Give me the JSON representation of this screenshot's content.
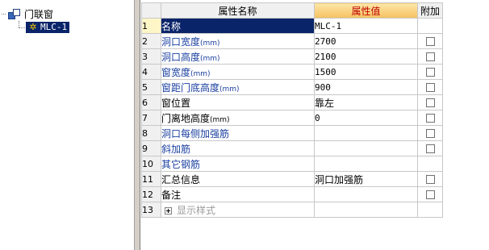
{
  "tree": {
    "root_label": "门联窗",
    "child_label": "MLC-1"
  },
  "grid": {
    "headers": {
      "name": "属性名称",
      "value": "属性值",
      "extra": "附加"
    },
    "rows": [
      {
        "num": "1",
        "name": "名称",
        "unit": "",
        "value": "MLC-1",
        "style": "blue",
        "checkbox": false,
        "selected": true
      },
      {
        "num": "2",
        "name": "洞口宽度",
        "unit": "(mm)",
        "value": "2700",
        "style": "blue",
        "checkbox": true
      },
      {
        "num": "3",
        "name": "洞口高度",
        "unit": "(mm)",
        "value": "2100",
        "style": "blue",
        "checkbox": true
      },
      {
        "num": "4",
        "name": "窗宽度",
        "unit": "(mm)",
        "value": "1500",
        "style": "blue",
        "checkbox": true
      },
      {
        "num": "5",
        "name": "窗距门底高度",
        "unit": "(mm)",
        "value": "900",
        "style": "blue",
        "checkbox": true
      },
      {
        "num": "6",
        "name": "窗位置",
        "unit": "",
        "value": "靠左",
        "style": "black",
        "checkbox": true
      },
      {
        "num": "7",
        "name": "门离地高度",
        "unit": "(mm)",
        "value": "0",
        "style": "black",
        "checkbox": true
      },
      {
        "num": "8",
        "name": "洞口每侧加强筋",
        "unit": "",
        "value": "",
        "style": "blue",
        "checkbox": true
      },
      {
        "num": "9",
        "name": "斜加筋",
        "unit": "",
        "value": "",
        "style": "blue",
        "checkbox": true
      },
      {
        "num": "10",
        "name": "其它钢筋",
        "unit": "",
        "value": "",
        "style": "blue",
        "checkbox": false
      },
      {
        "num": "11",
        "name": "汇总信息",
        "unit": "",
        "value": "洞口加强筋",
        "style": "black",
        "checkbox": true
      },
      {
        "num": "12",
        "name": "备注",
        "unit": "",
        "value": "",
        "style": "black",
        "checkbox": true
      },
      {
        "num": "13",
        "name": "显示样式",
        "unit": "",
        "value": "",
        "style": "gray",
        "checkbox": false,
        "expandable": true
      }
    ]
  },
  "colors": {
    "selection": "#0a246a",
    "blue_text": "#1a3fa0",
    "value_header": "#c00000"
  }
}
